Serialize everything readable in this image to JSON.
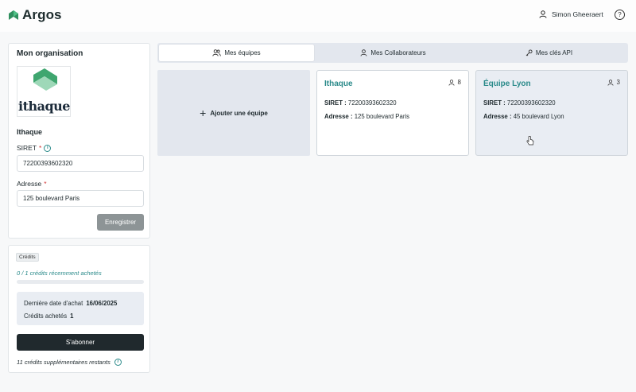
{
  "header": {
    "app_name": "Argos",
    "user_name": "Simon Gheeraert",
    "help_glyph": "?"
  },
  "organization": {
    "title": "Mon organisation",
    "logo_text": "ithaque",
    "name": "Ithaque",
    "siret_label": "SIRET",
    "siret_value": "72200393602320",
    "address_label": "Adresse",
    "address_value": "125 boulevard Paris",
    "required_mark": "*",
    "save_label": "Enregistrer"
  },
  "credits": {
    "badge": "Crédits",
    "usage_text": "0 / 1 crédits récemment achetés",
    "usage_fraction": 0,
    "last_purchase_label": "Dernière date d'achat",
    "last_purchase_value": "16/06/2025",
    "purchased_label": "Crédits achetés",
    "purchased_value": "1",
    "subscribe_label": "S'abonner",
    "remaining_text": "11 crédits supplémentaires restants"
  },
  "tabs": [
    {
      "label": "Mes équipes",
      "icon": "users-icon",
      "active": true
    },
    {
      "label": "Mes Collaborateurs",
      "icon": "user-icon",
      "active": false
    },
    {
      "label": "Mes clés API",
      "icon": "key-icon",
      "active": false
    }
  ],
  "teams": {
    "add_label": "Ajouter une équipe",
    "add_glyph": "+",
    "items": [
      {
        "name": "Ithaque",
        "members": "8",
        "siret_label": "SIRET :",
        "siret": "72200393602320",
        "address_label": "Adresse :",
        "address": "125 boulevard Paris"
      },
      {
        "name": "Équipe Lyon",
        "members": "3",
        "siret_label": "SIRET :",
        "siret": "72200393602320",
        "address_label": "Adresse :",
        "address": "45 boulevard Lyon"
      }
    ]
  },
  "colors": {
    "accent": "#2a8a8a",
    "dark_button": "#20292d",
    "disabled_button": "#8d9496",
    "tab_bg": "#e3e7ee",
    "hovered_card_bg": "#e9edf3"
  }
}
